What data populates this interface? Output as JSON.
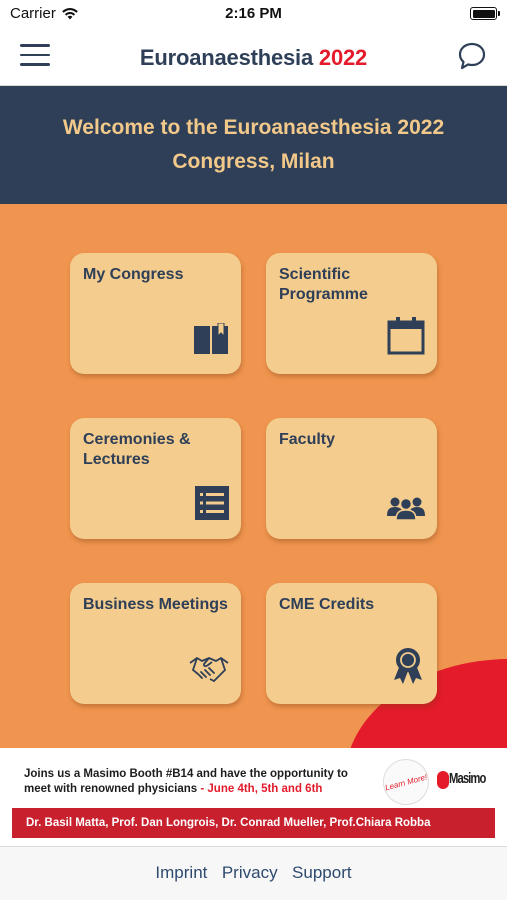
{
  "status_bar": {
    "carrier": "Carrier",
    "time": "2:16 PM"
  },
  "nav": {
    "title_name": "Euroanaesthesia",
    "title_year": "2022"
  },
  "welcome": {
    "heading": "Welcome to the Euroanaesthesia 2022 Congress, Milan"
  },
  "tiles": [
    {
      "label": "My Congress",
      "icon": "book-icon"
    },
    {
      "label": "Scientific Programme",
      "icon": "calendar-icon"
    },
    {
      "label": "Ceremonies & Lectures",
      "icon": "list-icon"
    },
    {
      "label": "Faculty",
      "icon": "people-icon"
    },
    {
      "label": "Business Meetings",
      "icon": "handshake-icon"
    },
    {
      "label": "CME Credits",
      "icon": "award-ribbon-icon"
    }
  ],
  "ad": {
    "text_main": "Joins us a Masimo Booth #B14 and have the opportunity to meet with renowned physicians",
    "text_dates": " - June 4th, 5th and 6th",
    "learn_more": "Learn More!",
    "brand": "Masimo",
    "speakers": "Dr. Basil Matta, Prof. Dan Longrois, Dr. Conrad Mueller,  Prof.Chiara Robba"
  },
  "footer": {
    "links": [
      "Imprint",
      "Privacy",
      "Support"
    ]
  },
  "colors": {
    "navy": "#2e3f57",
    "accent_red": "#e31b2a",
    "orange_bg": "#f0954f",
    "tile_bg": "#f3cc8e",
    "banner_text": "#f2c98a"
  }
}
